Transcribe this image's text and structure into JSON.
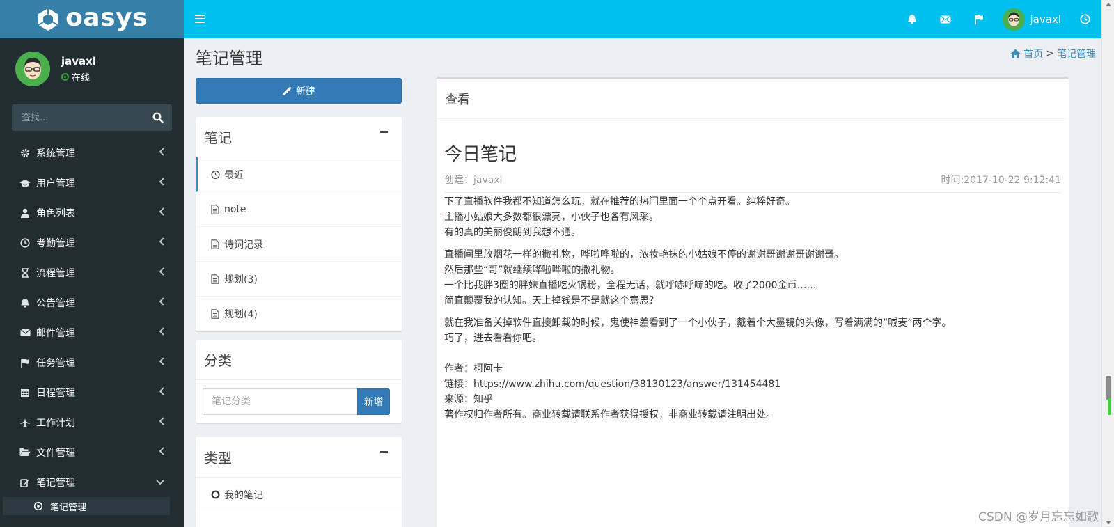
{
  "app": {
    "logo_text": "oasys"
  },
  "colors": {
    "sidebar_bg": "#222d32",
    "header_bg": "#00c0ef",
    "logo_bg": "#367fa9",
    "primary": "#337ab7",
    "accent": "#3c8dbc"
  },
  "user": {
    "name": "javaxl",
    "status": "在线"
  },
  "sidebar": {
    "search_placeholder": "查找...",
    "items": [
      {
        "label": "系统管理",
        "icon": "gear-icon"
      },
      {
        "label": "用户管理",
        "icon": "graduation-cap-icon"
      },
      {
        "label": "角色列表",
        "icon": "user-icon"
      },
      {
        "label": "考勤管理",
        "icon": "clock-icon"
      },
      {
        "label": "流程管理",
        "icon": "hourglass-icon"
      },
      {
        "label": "公告管理",
        "icon": "bell-icon"
      },
      {
        "label": "邮件管理",
        "icon": "envelope-icon"
      },
      {
        "label": "任务管理",
        "icon": "flag-icon"
      },
      {
        "label": "日程管理",
        "icon": "calendar-icon"
      },
      {
        "label": "工作计划",
        "icon": "plane-icon"
      },
      {
        "label": "文件管理",
        "icon": "folder-open-icon"
      },
      {
        "label": "笔记管理",
        "icon": "edit-icon",
        "expanded": true
      }
    ],
    "subitem": {
      "label": "笔记管理",
      "icon": "circle-icon"
    }
  },
  "header": {
    "user_name": "javaxl"
  },
  "content": {
    "page_title": "笔记管理",
    "breadcrumb": {
      "home": "首页",
      "separator": ">",
      "current": "笔记管理"
    },
    "new_button": "新建",
    "notes_box": {
      "title": "笔记",
      "items": [
        {
          "label": "最近",
          "icon": "clock-icon",
          "active": true
        },
        {
          "label": "note",
          "icon": "file-icon"
        },
        {
          "label": "诗词记录",
          "icon": "file-icon"
        },
        {
          "label": "规划(3)",
          "icon": "file-icon"
        },
        {
          "label": "规划(4)",
          "icon": "file-icon"
        }
      ]
    },
    "category_box": {
      "title": "分类",
      "input_placeholder": "笔记分类",
      "add_button": "新增"
    },
    "type_box": {
      "title": "类型",
      "items": [
        {
          "label": "我的笔记",
          "icon": "circle-icon"
        }
      ]
    },
    "view": {
      "header": "查看",
      "title": "今日笔记",
      "creator": "创建：javaxl",
      "time": "时间:2017-10-22 9:12:41",
      "paragraphs": [
        [
          "下了直播软件我都不知道怎么玩，就在推荐的热门里面一个个点开看。纯粹好奇。",
          "主播小姑娘大多数都很漂亮，小伙子也各有风采。",
          "有的真的美丽俊朗到我想不通。"
        ],
        [
          "直播间里放烟花一样的撒礼物，哗啦哗啦的，浓妆艳抹的小姑娘不停的谢谢哥谢谢哥谢谢哥。",
          "然后那些“哥”就继续哗啦哗啦的撒礼物。",
          "一个比我胖3圈的胖妹直播吃火锅粉，全程无话，就呼哧呼哧的吃。收了2000金币……",
          "简直颠覆我的认知。天上掉钱是不是就这个意思？"
        ],
        [
          "就在我准备关掉软件直接卸载的时候，鬼使神差看到了一个小伙子，戴着个大墨镜的头像，写着满满的“喊麦”两个字。",
          "巧了，进去看看你吧。"
        ]
      ],
      "source": [
        "作者：柯阿卡",
        "链接：https://www.zhihu.com/question/38130123/answer/131454481",
        "来源：知乎",
        "著作权归作者所有。商业转载请联系作者获得授权，非商业转载请注明出处。"
      ]
    }
  },
  "watermark": "CSDN @岁月忘忘如歌"
}
